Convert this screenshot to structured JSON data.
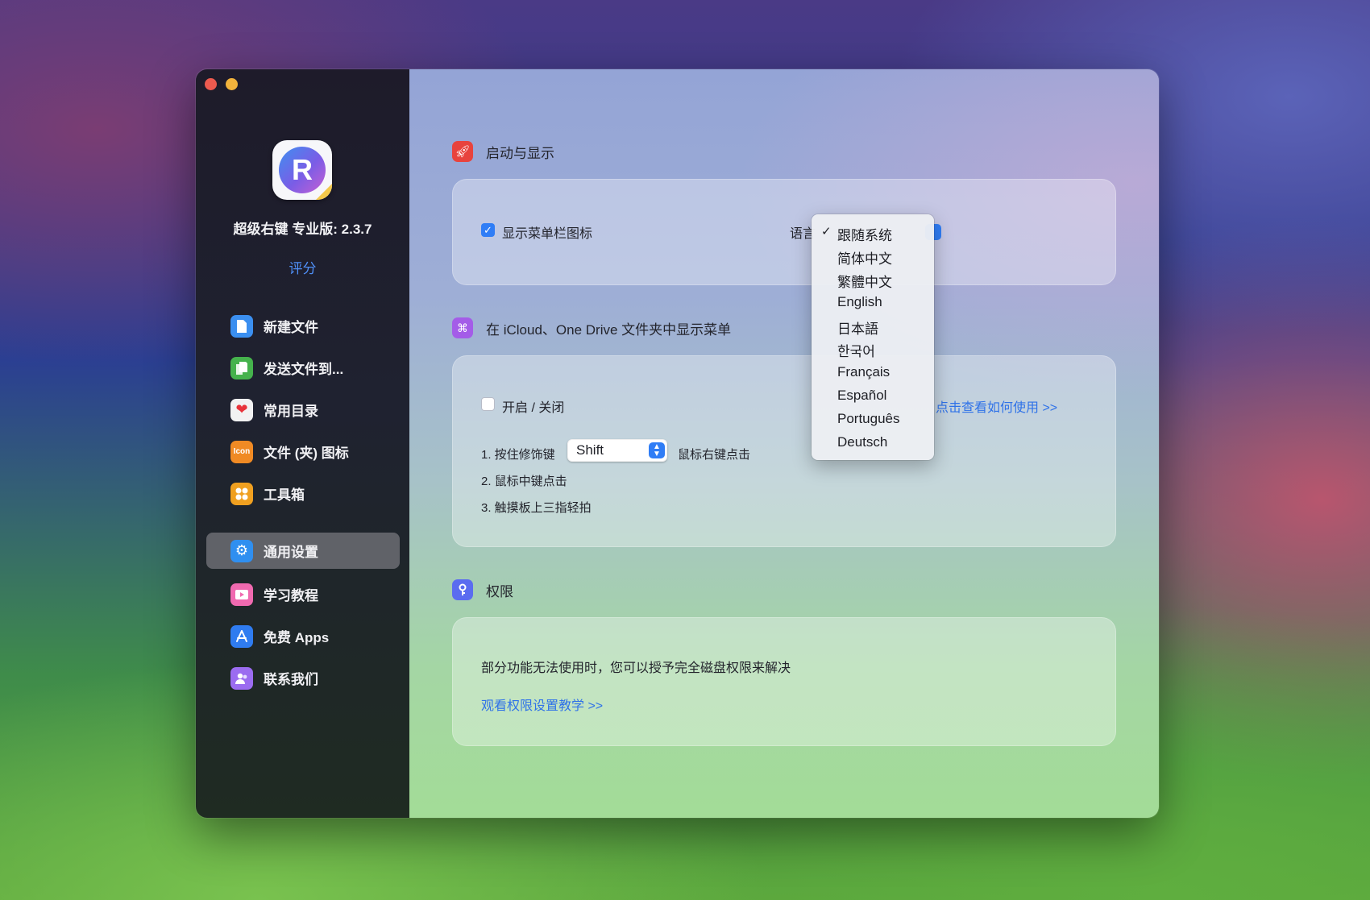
{
  "sidebar": {
    "app_name": "超级右键 专业版: 2.3.7",
    "rate_label": "评分",
    "items": [
      {
        "label": "新建文件",
        "icon": "new-file-icon",
        "color": "#3b8ff0"
      },
      {
        "label": "发送文件到...",
        "icon": "send-file-icon",
        "color": "#45b24c"
      },
      {
        "label": "常用目录",
        "icon": "heart-icon",
        "color": "#f2f2f2"
      },
      {
        "label": "文件 (夹) 图标",
        "icon": "icon-badge",
        "color": "#f08a24",
        "badge_text": "Icon"
      },
      {
        "label": "工具箱",
        "icon": "toolbox-icon",
        "color": "#f0a020"
      },
      {
        "label": "通用设置",
        "icon": "gear-icon",
        "color": "#2f8ff0"
      },
      {
        "label": "学习教程",
        "icon": "tutorial-icon",
        "color": "#f06ab0"
      },
      {
        "label": "免费 Apps",
        "icon": "app-store-icon",
        "color": "#2f7cf0"
      },
      {
        "label": "联系我们",
        "icon": "contact-icon",
        "color": "#9b6cf0"
      }
    ],
    "active_index": 5
  },
  "sections": {
    "startup": {
      "title": "启动与显示",
      "icon": "rocket-icon",
      "show_menubar_label": "显示菜单栏图标",
      "show_menubar_checked": true,
      "language_label": "语言"
    },
    "icloud": {
      "title": "在 iCloud、One Drive 文件夹中显示菜单",
      "icon": "command-icon",
      "toggle_label": "开启 / 关闭",
      "toggle_checked": false,
      "howto_link": "点击查看如何使用 >>",
      "step1_prefix": "1. 按住修饰键",
      "modifier_value": "Shift",
      "step1_suffix": "鼠标右键点击",
      "step2": "2. 鼠标中键点击",
      "step3": "3. 触摸板上三指轻拍"
    },
    "permissions": {
      "title": "权限",
      "icon": "key-icon",
      "description": "部分功能无法使用时，您可以授予完全磁盘权限来解决",
      "link": "观看权限设置教学 >>"
    }
  },
  "language_menu": {
    "options": [
      "跟随系统",
      "简体中文",
      "繁體中文",
      "English",
      "日本語",
      "한국어",
      "Français",
      "Español",
      "Português",
      "Deutsch"
    ],
    "selected_index": 0
  },
  "colors": {
    "accent": "#2f7df6",
    "link": "#2f72e8"
  }
}
